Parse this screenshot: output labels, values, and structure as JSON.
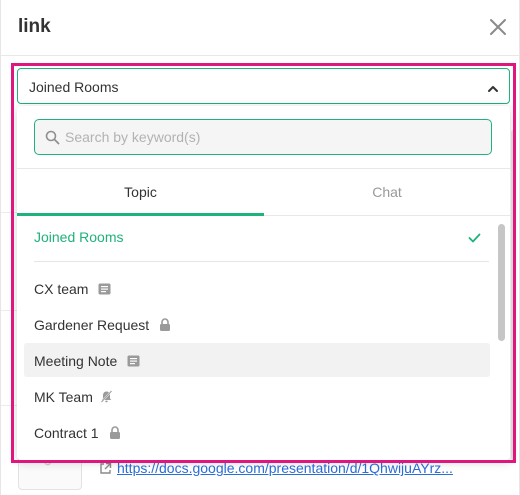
{
  "dialog": {
    "title": "link",
    "link_text": "https://docs.google.com/presentation/d/1QhwijuAYrz..."
  },
  "selector": {
    "value": "Joined Rooms"
  },
  "search": {
    "placeholder": "Search by keyword(s)"
  },
  "tabs": [
    {
      "label": "Topic",
      "active": true
    },
    {
      "label": "Chat",
      "active": false
    }
  ],
  "list": {
    "items": [
      {
        "label": "Joined Rooms",
        "icon": "check-icon",
        "selected": true
      },
      {
        "label": "CX team",
        "icon": "note-icon"
      },
      {
        "label": "Gardener Request",
        "icon": "lock-icon"
      },
      {
        "label": "Meeting Note",
        "icon": "note-icon",
        "hovered": true
      },
      {
        "label": "MK Team",
        "icon": "bell-off-icon"
      },
      {
        "label": "Contract 1",
        "icon": "lock-icon"
      }
    ]
  },
  "colors": {
    "accent": "#1fb27a",
    "highlight": "#e0167f",
    "link": "#2a6ed8"
  }
}
